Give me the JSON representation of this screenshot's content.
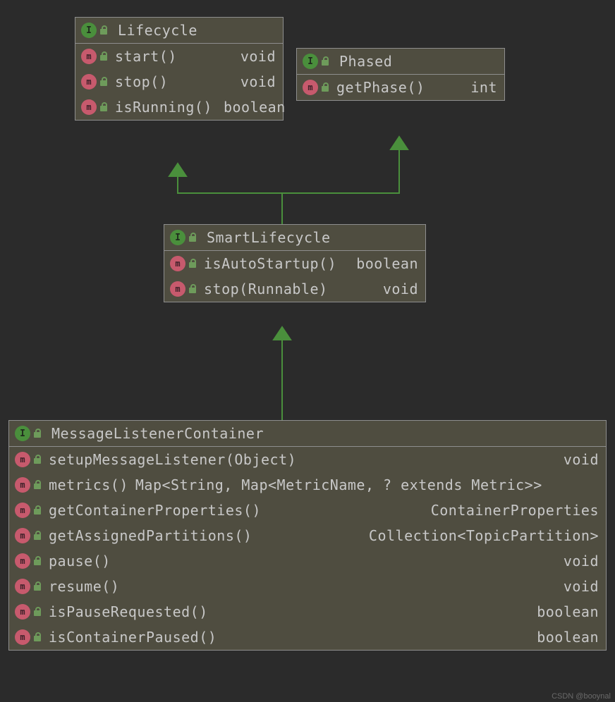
{
  "classes": {
    "lifecycle": {
      "name": "Lifecycle",
      "methods": [
        {
          "name": "start()",
          "ret": "void"
        },
        {
          "name": "stop()",
          "ret": "void"
        },
        {
          "name": "isRunning()",
          "ret": "boolean"
        }
      ]
    },
    "phased": {
      "name": "Phased",
      "methods": [
        {
          "name": "getPhase()",
          "ret": "int"
        }
      ]
    },
    "smartlifecycle": {
      "name": "SmartLifecycle",
      "methods": [
        {
          "name": "isAutoStartup()",
          "ret": "boolean"
        },
        {
          "name": "stop(Runnable)",
          "ret": "void"
        }
      ]
    },
    "messagelistener": {
      "name": "MessageListenerContainer",
      "methods": [
        {
          "name": "setupMessageListener(Object)",
          "ret": "void"
        },
        {
          "name": "metrics()",
          "ret": "Map<String, Map<MetricName, ? extends Metric>>"
        },
        {
          "name": "getContainerProperties()",
          "ret": "ContainerProperties"
        },
        {
          "name": "getAssignedPartitions()",
          "ret": "Collection<TopicPartition>"
        },
        {
          "name": "pause()",
          "ret": "void"
        },
        {
          "name": "resume()",
          "ret": "void"
        },
        {
          "name": "isPauseRequested()",
          "ret": "boolean"
        },
        {
          "name": "isContainerPaused()",
          "ret": "boolean"
        }
      ]
    }
  },
  "watermark": "CSDN @booynal"
}
